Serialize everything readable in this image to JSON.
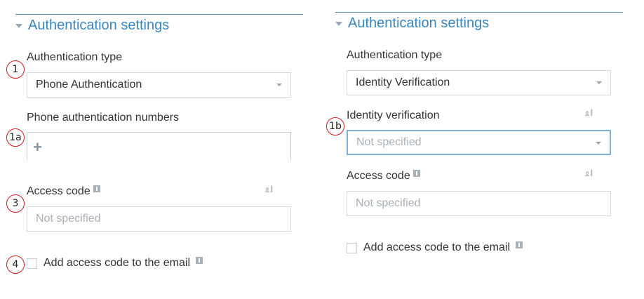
{
  "left": {
    "section_title": "Authentication settings",
    "badges": [
      "1",
      "1a",
      "3",
      "4"
    ],
    "auth_type": {
      "label": "Authentication type",
      "value": "Phone Authentication"
    },
    "phone_numbers": {
      "label": "Phone authentication numbers",
      "add_symbol": "+"
    },
    "access_code": {
      "label": "Access code",
      "placeholder": "Not specified",
      "link_icon_text": "ᦸI"
    },
    "add_to_email": {
      "label": "Add access code to the email",
      "checked": false
    }
  },
  "right": {
    "section_title": "Authentication settings",
    "badges": [
      "1b"
    ],
    "auth_type": {
      "label": "Authentication type",
      "value": "Identity Verification"
    },
    "identity_verification": {
      "label": "Identity verification",
      "placeholder": "Not specified",
      "link_icon_text": "ᦸI"
    },
    "access_code": {
      "label": "Access code",
      "placeholder": "Not specified",
      "link_icon_text": "ᦸI"
    },
    "add_to_email": {
      "label": "Add access code to the email",
      "checked": false
    }
  },
  "colors": {
    "accent": "#3a87c0",
    "badge_ring": "#d11f1f",
    "focus": "#7fb1d8"
  }
}
